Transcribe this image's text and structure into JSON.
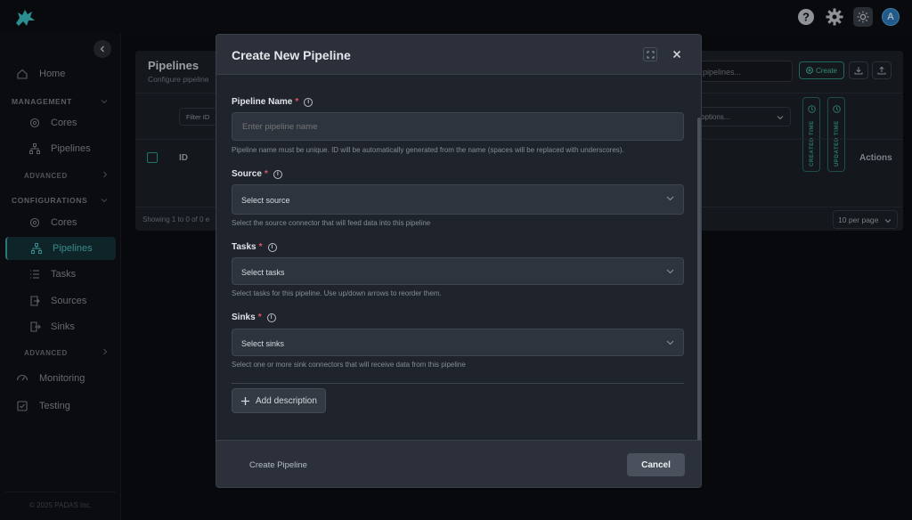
{
  "sidebar": {
    "items": [
      {
        "label": "Home"
      },
      {
        "label": "Cores"
      },
      {
        "label": "Pipelines"
      },
      {
        "label": "Cores"
      },
      {
        "label": "Pipelines"
      },
      {
        "label": "Tasks"
      },
      {
        "label": "Sources"
      },
      {
        "label": "Sinks"
      },
      {
        "label": "Monitoring"
      },
      {
        "label": "Testing"
      }
    ],
    "sections": {
      "management": "MANAGEMENT",
      "configurations": "CONFIGURATIONS",
      "advanced": "ADVANCED"
    },
    "footer": "© 2025 PADAS Inc."
  },
  "topbar": {
    "avatar_initial": "A"
  },
  "page": {
    "title": "Pipelines",
    "subtitle": "Configure pipeline",
    "search_placeholder": "pipelines...",
    "create_label": "Create",
    "filter_label": "Filter ID",
    "options_label": "options...",
    "created_time": "CREATED TIME",
    "updated_time": "UPDATED TIME",
    "col_id": "ID",
    "col_actions": "Actions",
    "showing": "Showing 1 to 0 of 0 e",
    "per_page": "10 per page"
  },
  "modal": {
    "title": "Create New Pipeline",
    "name_label": "Pipeline Name",
    "name_placeholder": "Enter pipeline name",
    "name_help": "Pipeline name must be unique. ID will be automatically generated from the name (spaces will be replaced with underscores).",
    "source_label": "Source",
    "source_value": "Select source",
    "source_help": "Select the source connector that will feed data into this pipeline",
    "tasks_label": "Tasks",
    "tasks_value": "Select tasks",
    "tasks_help": "Select tasks for this pipeline. Use up/down arrows to reorder them.",
    "sinks_label": "Sinks",
    "sinks_value": "Select sinks",
    "sinks_help": "Select one or more sink connectors that will receive data from this pipeline",
    "add_description": "Add description",
    "create_button": "Create Pipeline",
    "cancel_button": "Cancel",
    "required_mark": "*"
  },
  "colors": {
    "accent": "#3aa8aa",
    "required": "#e05565",
    "modal_bg": "#262b34"
  }
}
